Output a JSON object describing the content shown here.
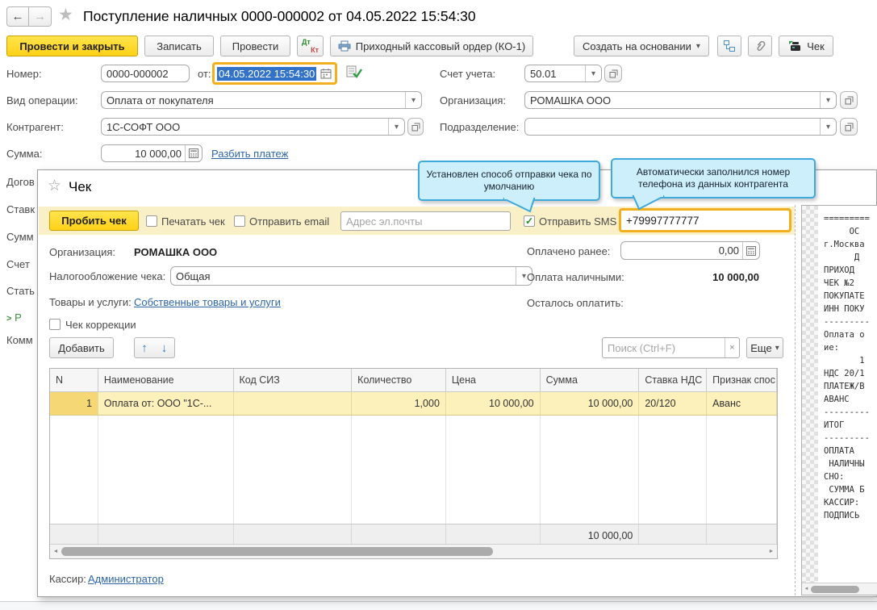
{
  "icons": {
    "back": "←",
    "forward": "→",
    "star": "★",
    "star_outline": "☆",
    "dropdown": "▾",
    "clear": "×",
    "check": "✓",
    "up": "↑",
    "down": "↓",
    "scroll_left": "◄",
    "scroll_right": "►",
    "chevron": ">"
  },
  "header": {
    "title": "Поступление наличных 0000-000002 от 04.05.2022 15:54:30"
  },
  "toolbar": {
    "post_close": "Провести и закрыть",
    "save": "Записать",
    "post": "Провести",
    "dt": "Дт",
    "kt": "Кт",
    "cash_order": "Приходный кассовый ордер (КО-1)",
    "create_based": "Создать на основании",
    "check": "Чек"
  },
  "form": {
    "number_label": "Номер:",
    "number_value": "0000-000002",
    "date_label": "от:",
    "date_value": "04.05.2022 15:54:30",
    "account_label": "Счет учета:",
    "account_value": "50.01",
    "operation_label": "Вид операции:",
    "operation_value": "Оплата от покупателя",
    "org_label": "Организация:",
    "org_value": "РОМАШКА ООО",
    "counterparty_label": "Контрагент:",
    "counterparty_value": "1С-СОФТ ООО",
    "division_label": "Подразделение:",
    "amount_label": "Сумма:",
    "amount_value": "10 000,00",
    "split_link": "Разбить платеж",
    "hidden_labels": [
      "Догов",
      "Ставк",
      "Сумм",
      "Счет",
      "Стать",
      "Комм"
    ],
    "details_link": "Р"
  },
  "tooltips": {
    "sms": "Установлен способ отправки чека по умолчанию",
    "phone": "Автоматически заполнился номер телефона из данных контрагента"
  },
  "dialog": {
    "title": "Чек",
    "toolbar": {
      "fiscal_btn": "Пробить чек",
      "print_cb": "Печатать чек",
      "email_cb": "Отправить email",
      "email_placeholder": "Адрес эл.почты",
      "sms_cb": "Отправить SMS",
      "phone_value": "+79997777777"
    },
    "org_label": "Организация:",
    "org_value": "РОМАШКА ООО",
    "tax_label": "Налогообложение чека:",
    "tax_value": "Общая",
    "goods_label": "Товары и услуги:",
    "goods_link": "Собственные товары и услуги",
    "correction_cb": "Чек коррекции",
    "paid_earlier_label": "Оплачено ранее:",
    "paid_earlier_value": "0,00",
    "cash_label": "Оплата наличными:",
    "cash_value": "10 000,00",
    "left_label": "Осталось оплатить:",
    "add_btn": "Добавить",
    "search_placeholder": "Поиск (Ctrl+F)",
    "more_btn": "Еще",
    "table": {
      "headers": [
        "N",
        "Наименование",
        "Код СИЗ",
        "Количество",
        "Цена",
        "Сумма",
        "Ставка НДС",
        "Признак спос"
      ],
      "row": [
        "1",
        "Оплата от: ООО \"1С-...",
        "",
        "1,000",
        "10 000,00",
        "10 000,00",
        "20/120",
        "Аванс"
      ],
      "footer_total": "10 000,00"
    },
    "cashier_label": "Кассир:",
    "cashier_link": "Администратор"
  },
  "receipt": {
    "lines": [
      "=========",
      "     ОС",
      "г.Москва",
      "      Д",
      "",
      "ПРИХОД",
      "ЧЕК №2",
      "ПОКУПАТЕ",
      "ИНН ПОКУ",
      "---------",
      "",
      "Оплата о",
      "ие:",
      "       1",
      "НДС 20/1",
      "ПЛАТЕЖ/В",
      "АВАНС",
      "",
      "",
      "---------",
      "ИТОГ",
      "---------",
      "ОПЛАТА",
      " НАЛИЧНЫ",
      "СНО:",
      " СУММА Б",
      "КАССИР:",
      "",
      "ПОДПИСЬ"
    ]
  }
}
